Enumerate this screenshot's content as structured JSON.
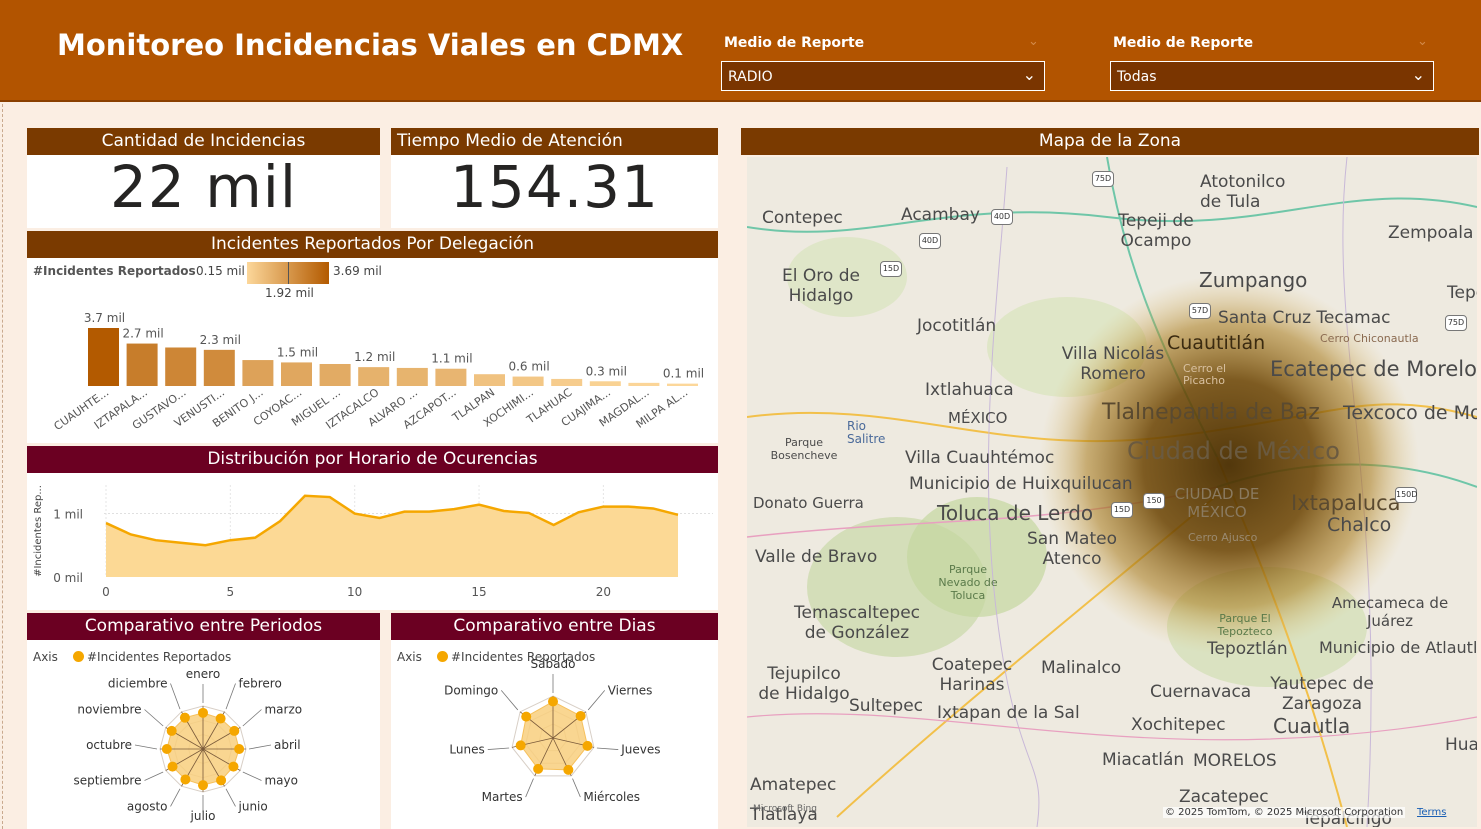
{
  "header": {
    "title": "Monitoreo Incidencias Viales en CDMX",
    "slicer1": {
      "label": "Medio de Reporte",
      "value": "RADIO"
    },
    "slicer2": {
      "label": "Medio de Reporte",
      "value": "Todas"
    }
  },
  "kpis": {
    "count_title": "Cantidad de Incidencias",
    "count_value": "22 mil",
    "time_title": "Tiempo Medio de Atención",
    "time_value": "154.31"
  },
  "bar_panel": {
    "title": "Incidentes Reportados Por Delegación",
    "legend_label": "#Incidentes Reportados",
    "legend_min": "0.15 mil",
    "legend_max": "3.69 mil",
    "legend_mid": "1.92 mil"
  },
  "line_panel": {
    "title": "Distribución por Horario de Ocurencias"
  },
  "radar_periods": {
    "title": "Comparativo entre Periodos",
    "axis_label": "Axis",
    "series_label": "#Incidentes Reportados"
  },
  "radar_days": {
    "title": "Comparativo entre Dias",
    "axis_label": "Axis",
    "series_label": "#Incidentes Reportados"
  },
  "map": {
    "title": "Mapa de la Zona",
    "attribution": "© 2025 TomTom, © 2025 Microsoft Corporation",
    "terms": "Terms",
    "bing": "Microsoft Bing",
    "labels": [
      "Contepec",
      "Acambay",
      "Atotonilco de Tula",
      "Tepeji de Ocampo",
      "Zempoala",
      "El Oro de Hidalgo",
      "Zumpango",
      "Tepea",
      "Jocotitlán",
      "Santa Cruz Tecamac",
      "Cuautitlán",
      "Villa Nicolás Romero",
      "Ecatepec de Morelos",
      "Ixtlahuaca",
      "Tlalnepantla de Baz",
      "Texcoco de Mo",
      "MÉXICO",
      "Ciudad de México",
      "Villa Cuauhtémoc",
      "Municipio de Huixquilucan",
      "Donato Guerra",
      "Toluca de Lerdo",
      "Ixtapaluca",
      "Chalco",
      "San Mateo Atenco",
      "Valle de Bravo",
      "Temascaltepec de González",
      "Amecameca de Juárez",
      "Tepoztlán",
      "Municipio de Atlautla",
      "Tejupilco de Hidalgo",
      "Coatepec Harinas",
      "Malinalco",
      "Sultepec",
      "Ixtapan de la Sal",
      "Cuernavaca",
      "Yautepec de Zaragoza",
      "Cuautla",
      "Xochitepec",
      "Huaq",
      "Miacatlán",
      "MORELOS",
      "Amatepec",
      "Zacatepec",
      "Tlatlaya",
      "Tepalcingo"
    ],
    "small_labels": [
      "Cerro Chiconautla",
      "Cerro el Picacho",
      "Rio Salitre",
      "Parque Bosencheve",
      "CIUDAD DE MÉXICO",
      "Cerro Ajusco",
      "Parque Nevado de Toluca",
      "Parque El Tepozteco"
    ]
  },
  "chart_data": [
    {
      "type": "bar",
      "title": "Incidentes Reportados Por Delegación",
      "categories": [
        "CUAUHTE...",
        "IZTAPALA...",
        "GUSTAVO...",
        "VENUSTI...",
        "BENITO J...",
        "COYOAC...",
        "MIGUEL ...",
        "IZTACALCO",
        "ALVARO ...",
        "AZCAPOT...",
        "TLALPAN",
        "XOCHIMI...",
        "TLAHUAC",
        "CUAJIMA...",
        "MAGDAL...",
        "MILPA AL..."
      ],
      "values": [
        3.69,
        2.7,
        2.45,
        2.3,
        1.65,
        1.5,
        1.4,
        1.2,
        1.15,
        1.1,
        0.75,
        0.6,
        0.45,
        0.3,
        0.2,
        0.15
      ],
      "data_labels": [
        "3.7 mil",
        "2.7 mil",
        "",
        "2.3 mil",
        "",
        "1.5 mil",
        "",
        "1.2 mil",
        "",
        "1.1 mil",
        "",
        "0.6 mil",
        "",
        "0.3 mil",
        "",
        "0.1 mil"
      ],
      "color_min": "#fcd79a",
      "color_max": "#b35a00"
    },
    {
      "type": "area",
      "title": "Distribución por Horario de Ocurencias",
      "ylabel": "#Incidentes Rep...",
      "x": [
        0,
        1,
        2,
        3,
        4,
        5,
        6,
        7,
        8,
        9,
        10,
        11,
        12,
        13,
        14,
        15,
        16,
        17,
        18,
        19,
        20,
        21,
        22,
        23
      ],
      "values": [
        0.85,
        0.67,
        0.58,
        0.54,
        0.5,
        0.58,
        0.62,
        0.88,
        1.28,
        1.26,
        1.0,
        0.93,
        1.03,
        1.03,
        1.07,
        1.14,
        1.04,
        1.01,
        0.82,
        1.02,
        1.11,
        1.11,
        1.08,
        0.98
      ],
      "xticks": [
        0,
        5,
        10,
        15,
        20
      ],
      "yticks": [
        "0 mil",
        "1 mil"
      ],
      "ylim": [
        0,
        1.45
      ],
      "color": "#f5a700"
    },
    {
      "type": "radar",
      "title": "Comparativo entre Periodos",
      "categories": [
        "enero",
        "febrero",
        "marzo",
        "abril",
        "mayo",
        "junio",
        "julio",
        "agosto",
        "septiembre",
        "octubre",
        "noviembre",
        "diciembre"
      ],
      "values": [
        1.85,
        1.8,
        1.85,
        1.85,
        1.8,
        1.85,
        1.85,
        1.8,
        1.8,
        1.85,
        1.85,
        1.85
      ]
    },
    {
      "type": "radar",
      "title": "Comparativo entre Dias",
      "categories": [
        "Sábado",
        "Viernes",
        "Jueves",
        "Miércoles",
        "Martes",
        "Lunes",
        "Domingo"
      ],
      "values": [
        3.3,
        3.2,
        3.2,
        3.2,
        3.1,
        3.0,
        3.1
      ]
    }
  ]
}
